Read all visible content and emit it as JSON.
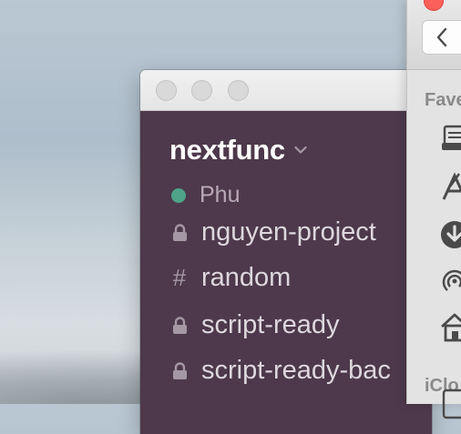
{
  "slack": {
    "team_name": "nextfunc",
    "user": {
      "name": "Phu",
      "status": "online"
    },
    "channels": [
      {
        "name": "nguyen-project",
        "type": "private",
        "icon": "lock-icon"
      },
      {
        "name": "random",
        "type": "public",
        "icon": "hash-icon"
      },
      {
        "name": "script-ready",
        "type": "private",
        "icon": "lock-icon"
      },
      {
        "name": "script-ready-bac",
        "type": "private",
        "icon": "lock-icon"
      }
    ],
    "colors": {
      "sidebar": "#4d394b",
      "presence": "#4fa389",
      "text": "#ded7dd"
    }
  },
  "finder": {
    "favorites_label": "Fave",
    "icloud_label": "iClo",
    "favorite_icons": [
      "all-files-icon",
      "applications-icon",
      "downloads-icon",
      "airdrop-icon",
      "home-icon"
    ]
  }
}
